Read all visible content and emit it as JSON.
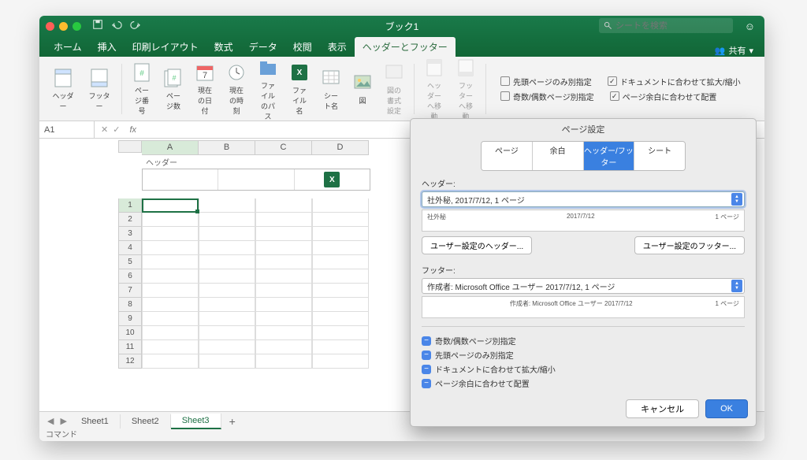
{
  "title": "ブック1",
  "search_placeholder": "シートを検索",
  "share": "共有",
  "tabs": [
    "ホーム",
    "挿入",
    "印刷レイアウト",
    "数式",
    "データ",
    "校閲",
    "表示",
    "ヘッダーとフッター"
  ],
  "active_tab": 7,
  "ribbon": {
    "header": "ヘッダー",
    "footer": "フッター",
    "page_number": "ページ番号",
    "page_count": "ページ数",
    "current_date": "現在の日付",
    "current_time": "現在の時刻",
    "file_path": "ファイルのパス",
    "file_name": "ファイル名",
    "sheet_name": "シート名",
    "picture": "図",
    "format_picture": "図の書式設定",
    "goto_header": "ヘッダーへ移動",
    "goto_footer": "フッターへ移動",
    "first_page_diff": "先頭ページのみ別指定",
    "scale_with_doc": "ドキュメントに合わせて拡大/縮小",
    "odd_even_diff": "奇数/偶数ページ別指定",
    "align_margins": "ページ余白に合わせて配置"
  },
  "namebox": "A1",
  "header_label": "ヘッダー",
  "columns": [
    "A",
    "B",
    "C",
    "D"
  ],
  "rows": [
    1,
    2,
    3,
    4,
    5,
    6,
    7,
    8,
    9,
    10,
    11,
    12
  ],
  "sheets": [
    "Sheet1",
    "Sheet2",
    "Sheet3"
  ],
  "active_sheet": 2,
  "status": "コマンド",
  "dialog": {
    "title": "ページ設定",
    "segs": [
      "ページ",
      "余白",
      "ヘッダー/フッター",
      "シート"
    ],
    "active_seg": 2,
    "header_label": "ヘッダー:",
    "header_value": "社外秘, 2017/7/12, 1 ページ",
    "header_preview_left": "社外秘",
    "header_preview_center": "2017/7/12",
    "header_preview_right": "1 ページ",
    "custom_header": "ユーザー設定のヘッダー...",
    "custom_footer": "ユーザー設定のフッター...",
    "footer_label": "フッター:",
    "footer_value": "作成者: Microsoft Office ユーザー 2017/7/12, 1 ページ",
    "footer_preview_center": "作成者: Microsoft Office ユーザー 2017/7/12",
    "footer_preview_right": "1 ページ",
    "checks": [
      "奇数/偶数ページ別指定",
      "先頭ページのみ別指定",
      "ドキュメントに合わせて拡大/縮小",
      "ページ余白に合わせて配置"
    ],
    "cancel": "キャンセル",
    "ok": "OK"
  }
}
